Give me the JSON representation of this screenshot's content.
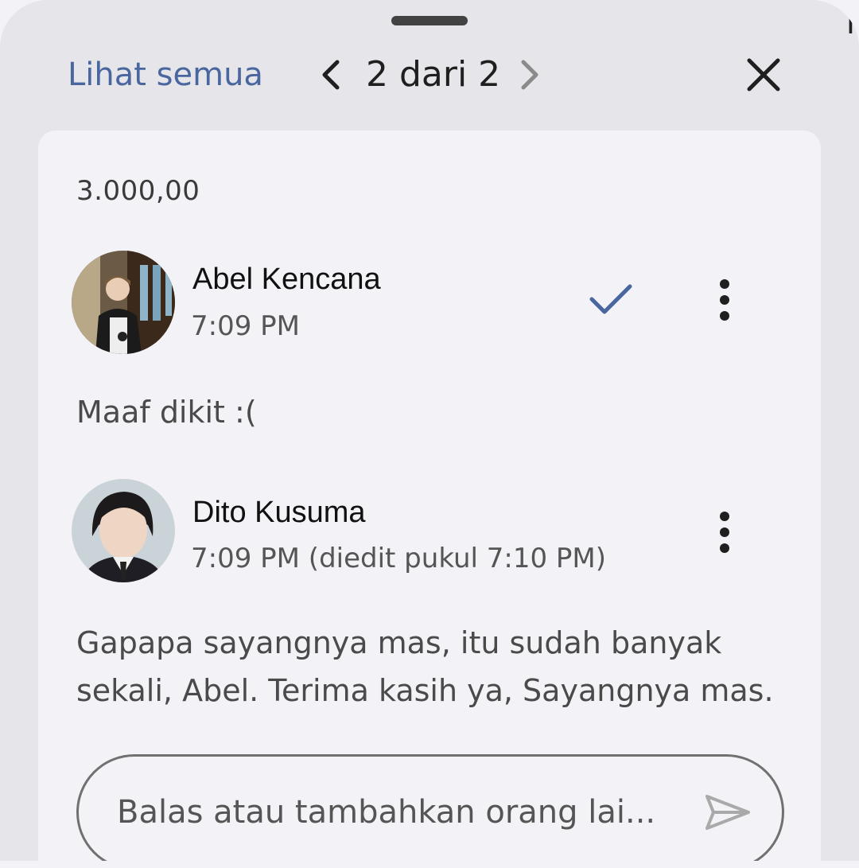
{
  "header": {
    "see_all_label": "Lihat semua",
    "counter": "2 dari 2",
    "prev_icon": "chevron-left-icon",
    "next_icon": "chevron-right-icon",
    "close_icon": "close-icon"
  },
  "card": {
    "amount": "3.000,00",
    "comments": [
      {
        "author": "Abel Kencana",
        "time": "7:09 PM",
        "body": "Maaf dikit :(",
        "resolved_icon": "check-icon",
        "menu_icon": "more-vert-icon"
      },
      {
        "author": "Dito Kusuma",
        "time": "7:09 PM (diedit pukul 7:10 PM)",
        "body_line1": "Gapapa sayangnya mas, itu sudah banyak",
        "body_line2": "sekali, Abel. Terima kasih ya, Sayangnya mas.",
        "menu_icon": "more-vert-icon"
      }
    ]
  },
  "reply": {
    "placeholder": "Balas atau tambahkan orang lai...",
    "send_icon": "send-icon"
  },
  "colors": {
    "accent": "#4a669e",
    "sheet_bg": "#e6e5ea",
    "card_bg": "#f3f2f7"
  }
}
